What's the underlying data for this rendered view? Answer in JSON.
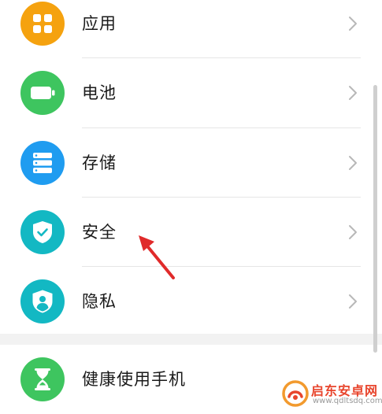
{
  "settings": {
    "items": [
      {
        "label": "应用",
        "icon": "apps-grid-icon",
        "color": "#f5a20f"
      },
      {
        "label": "电池",
        "icon": "battery-icon",
        "color": "#3ec55f"
      },
      {
        "label": "存储",
        "icon": "storage-icon",
        "color": "#1f9cf0"
      },
      {
        "label": "安全",
        "icon": "shield-check-icon",
        "color": "#13b8c3"
      },
      {
        "label": "隐私",
        "icon": "privacy-shield-icon",
        "color": "#13b8c3"
      },
      {
        "label": "健康使用手机",
        "icon": "hourglass-icon",
        "color": "#3ec55f"
      }
    ]
  },
  "watermark": {
    "title": "启东安卓网",
    "url": "www.qdltsdq.com",
    "color": "#e8452d"
  },
  "annotation": {
    "arrow_color": "#e02a2a"
  }
}
